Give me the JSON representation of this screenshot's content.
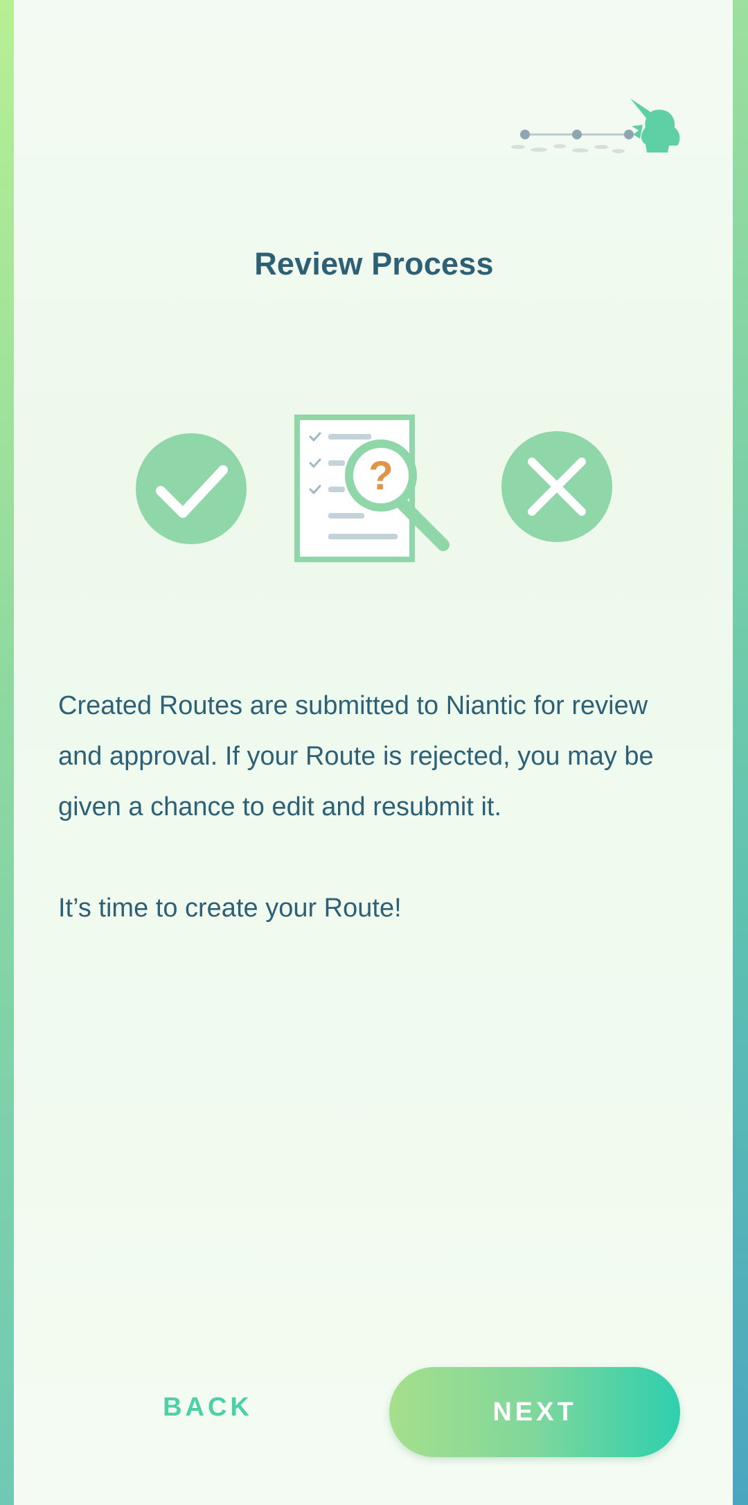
{
  "screen": {
    "title": "Review Process",
    "body_paragraphs": [
      "Created Routes are submitted to Niantic for review and approval. If your Route is rejected, you may be given a chance to edit and resubmit it.",
      "It’s time to create your Route!"
    ]
  },
  "progress": {
    "total_steps": 3,
    "current_step": 3
  },
  "illustration": {
    "icons": [
      "checkmark-circle-icon",
      "document-review-icon",
      "magnifier-question-icon",
      "x-circle-icon"
    ],
    "question_mark": "?"
  },
  "buttons": {
    "back_label": "BACK",
    "next_label": "NEXT"
  },
  "colors": {
    "title_text": "#2e6075",
    "accent_green": "#8fd6a8",
    "back_text": "#4dcfa8",
    "question_orange": "#e0944a"
  }
}
